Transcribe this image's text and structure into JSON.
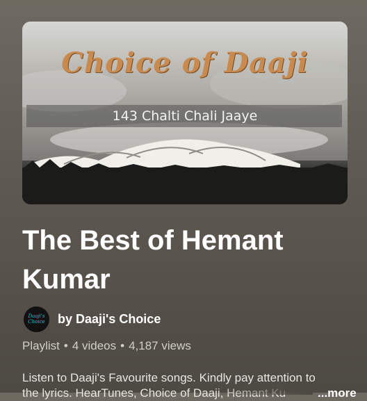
{
  "playlist": {
    "thumbnail": {
      "brand_text": "Choice of Daaji",
      "song_text": "143 Chalti Chali Jaaye"
    },
    "title": "The Best of Hemant Kumar",
    "owner": {
      "avatar_text": "Daaji's Choice",
      "label": "by Daaji's Choice"
    },
    "meta": {
      "type": "Playlist",
      "videos": "4 videos",
      "views": "4,187 views",
      "separator": "•"
    },
    "description": "Listen to Daaji's Favourite songs. Kindly pay attention to the lyrics. HearTunes, Choice of Daaji, Hemant Ku",
    "more_label": "...more"
  },
  "colors": {
    "brand_orange": "#c88a4f",
    "avatar_cyan": "#20c5d6"
  }
}
